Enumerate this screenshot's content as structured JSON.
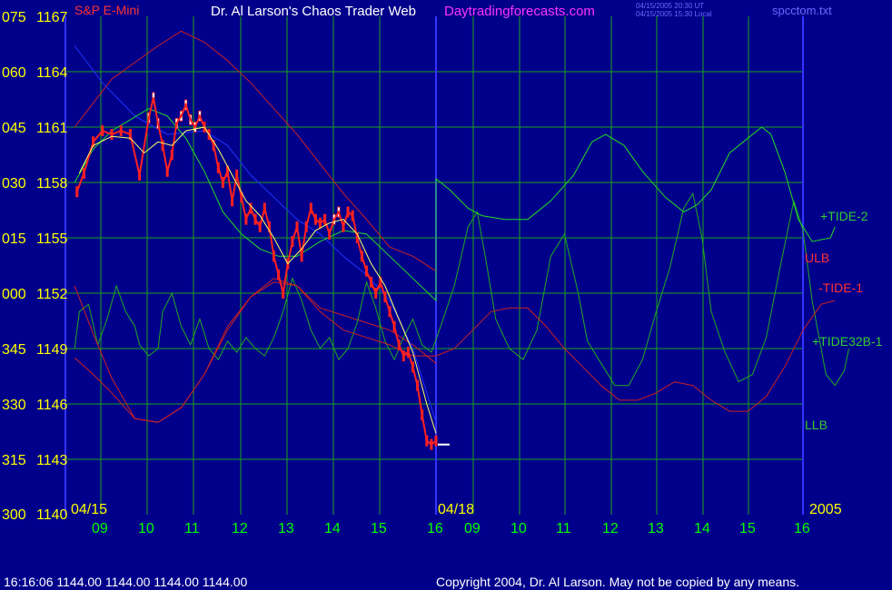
{
  "header": {
    "instrument": "S&P E-Mini",
    "title": "Dr. Al Larson's Chaos Trader Web",
    "site": "Daytradingforecasts.com",
    "stamp_ut": "04/15/2005 20:30 UT",
    "stamp_local": "04/15/2005 15:30 Local",
    "file": "spcctom.txt"
  },
  "footer": {
    "status": "16:16:06  1144.00 1144.00 1144.00 1144.00",
    "copyright": "Copyright 2004, Dr. Al Larson. May not be copied by any means."
  },
  "colors": {
    "background": "#00008b",
    "grid": "#1aa31a",
    "divider": "#3333ff",
    "price": "#ff2020",
    "price_highlight": "#ffffff",
    "ma": "#ffff66",
    "tide2": "#22dd22",
    "tide32b": "#22aa22",
    "tide1": "#cc2222",
    "channel_blue": "#2233ff",
    "lbl_red": "#ff3030",
    "lbl_green": "#33cc33",
    "tick": "#ffff00",
    "hour_tick": "#00ff00"
  },
  "chart_data": {
    "type": "line",
    "title": "",
    "xlabel": "",
    "ylabel": "",
    "ylim": [
      1140,
      1167
    ],
    "y_ticks": [
      {
        "left": "075",
        "right": "1167",
        "value": 1167
      },
      {
        "left": "060",
        "right": "1164",
        "value": 1164
      },
      {
        "left": "045",
        "right": "1161",
        "value": 1161
      },
      {
        "left": "030",
        "right": "1158",
        "value": 1158
      },
      {
        "left": "015",
        "right": "1155",
        "value": 1155
      },
      {
        "left": "000",
        "right": "1152",
        "value": 1152
      },
      {
        "left": "345",
        "right": "1149",
        "value": 1149
      },
      {
        "left": "330",
        "right": "1146",
        "value": 1146
      },
      {
        "left": "315",
        "right": "1143",
        "value": 1143
      },
      {
        "left": "300",
        "right": "1140",
        "value": 1140
      }
    ],
    "x_hours": [
      "09",
      "10",
      "11",
      "12",
      "13",
      "14",
      "15",
      "16",
      "09",
      "10",
      "11",
      "12",
      "13",
      "14",
      "15",
      "16"
    ],
    "date_labels": [
      "04/15",
      "04/18"
    ],
    "year_label": "2005",
    "grid": true,
    "series_labels": [
      {
        "name": "+TIDE-2",
        "color": "lbl_green"
      },
      {
        "name": "ULB",
        "color": "lbl_red"
      },
      {
        "name": "-TIDE-1",
        "color": "lbl_red"
      },
      {
        "name": "+TIDE32B-1",
        "color": "lbl_green"
      },
      {
        "name": "LLB",
        "color": "lbl_green"
      }
    ],
    "x_domain": [
      8.2,
      24.0
    ],
    "price_close": [
      [
        8.25,
        1157.5
      ],
      [
        8.4,
        1158.5
      ],
      [
        8.6,
        1160.2
      ],
      [
        8.8,
        1160.8
      ],
      [
        9.0,
        1160.6
      ],
      [
        9.2,
        1160.8
      ],
      [
        9.4,
        1160.6
      ],
      [
        9.6,
        1158.4
      ],
      [
        9.8,
        1161.5
      ],
      [
        9.9,
        1162.6
      ],
      [
        10.0,
        1161.2
      ],
      [
        10.1,
        1160.0
      ],
      [
        10.2,
        1158.6
      ],
      [
        10.3,
        1159.5
      ],
      [
        10.4,
        1161.2
      ],
      [
        10.5,
        1161.6
      ],
      [
        10.6,
        1162.2
      ],
      [
        10.7,
        1161.4
      ],
      [
        10.8,
        1161.0
      ],
      [
        10.9,
        1161.6
      ],
      [
        11.0,
        1161.0
      ],
      [
        11.1,
        1160.6
      ],
      [
        11.2,
        1160.0
      ],
      [
        11.3,
        1158.8
      ],
      [
        11.4,
        1158.0
      ],
      [
        11.5,
        1158.6
      ],
      [
        11.6,
        1157.0
      ],
      [
        11.7,
        1158.4
      ],
      [
        11.8,
        1157.2
      ],
      [
        11.9,
        1156.0
      ],
      [
        12.0,
        1156.6
      ],
      [
        12.1,
        1156.0
      ],
      [
        12.2,
        1155.6
      ],
      [
        12.3,
        1156.6
      ],
      [
        12.4,
        1155.6
      ],
      [
        12.5,
        1154.0
      ],
      [
        12.6,
        1153.0
      ],
      [
        12.7,
        1152.0
      ],
      [
        12.8,
        1153.6
      ],
      [
        12.9,
        1154.8
      ],
      [
        13.0,
        1155.6
      ],
      [
        13.1,
        1154.0
      ],
      [
        13.2,
        1155.6
      ],
      [
        13.3,
        1156.6
      ],
      [
        13.4,
        1156.0
      ],
      [
        13.5,
        1155.8
      ],
      [
        13.6,
        1156.0
      ],
      [
        13.7,
        1155.2
      ],
      [
        13.8,
        1156.0
      ],
      [
        13.9,
        1156.4
      ],
      [
        14.0,
        1155.6
      ],
      [
        14.1,
        1156.4
      ],
      [
        14.2,
        1156.2
      ],
      [
        14.3,
        1155.0
      ],
      [
        14.4,
        1154.0
      ],
      [
        14.5,
        1153.2
      ],
      [
        14.6,
        1152.6
      ],
      [
        14.7,
        1152.0
      ],
      [
        14.8,
        1152.6
      ],
      [
        14.9,
        1151.8
      ],
      [
        15.0,
        1151.0
      ],
      [
        15.1,
        1150.2
      ],
      [
        15.2,
        1149.2
      ],
      [
        15.3,
        1148.6
      ],
      [
        15.4,
        1148.8
      ],
      [
        15.5,
        1148.0
      ],
      [
        15.6,
        1147.0
      ],
      [
        15.7,
        1145.4
      ],
      [
        15.8,
        1144.0
      ],
      [
        15.9,
        1143.8
      ],
      [
        16.0,
        1144.0
      ]
    ],
    "price_white": [
      [
        9.8,
        1161.5
      ],
      [
        9.9,
        1162.6
      ],
      [
        10.0,
        1161.2
      ],
      [
        10.4,
        1161.2
      ],
      [
        10.5,
        1161.6
      ],
      [
        10.6,
        1162.2
      ],
      [
        10.7,
        1161.4
      ],
      [
        10.8,
        1161.0
      ],
      [
        10.9,
        1161.6
      ],
      [
        13.8,
        1156.0
      ],
      [
        13.9,
        1156.4
      ]
    ],
    "moving_avg": [
      [
        8.3,
        1158.5
      ],
      [
        8.6,
        1160.0
      ],
      [
        9.0,
        1160.5
      ],
      [
        9.4,
        1160.4
      ],
      [
        9.7,
        1159.6
      ],
      [
        10.0,
        1160.2
      ],
      [
        10.3,
        1160.0
      ],
      [
        10.6,
        1160.8
      ],
      [
        11.0,
        1161.0
      ],
      [
        11.3,
        1159.8
      ],
      [
        11.6,
        1158.4
      ],
      [
        11.9,
        1157.0
      ],
      [
        12.2,
        1156.2
      ],
      [
        12.5,
        1155.0
      ],
      [
        12.8,
        1153.6
      ],
      [
        13.1,
        1154.4
      ],
      [
        13.4,
        1155.4
      ],
      [
        13.7,
        1155.8
      ],
      [
        14.0,
        1156.0
      ],
      [
        14.3,
        1155.2
      ],
      [
        14.6,
        1153.6
      ],
      [
        14.9,
        1152.4
      ],
      [
        15.2,
        1150.6
      ],
      [
        15.5,
        1148.8
      ],
      [
        15.8,
        1146.0
      ],
      [
        16.0,
        1144.4
      ]
    ],
    "upper_channel": [
      [
        8.2,
        1161.0
      ],
      [
        9.0,
        1163.6
      ],
      [
        10.0,
        1165.4
      ],
      [
        10.5,
        1166.2
      ],
      [
        11.0,
        1165.6
      ],
      [
        11.5,
        1164.6
      ],
      [
        12.0,
        1163.4
      ],
      [
        12.5,
        1162.0
      ],
      [
        13.0,
        1160.6
      ],
      [
        13.5,
        1159.0
      ],
      [
        14.0,
        1157.4
      ],
      [
        14.5,
        1156.0
      ],
      [
        15.0,
        1154.5
      ],
      [
        15.5,
        1154.0
      ],
      [
        16.0,
        1153.2
      ]
    ],
    "lower_channel": [
      [
        8.2,
        1148.5
      ],
      [
        8.6,
        1147.6
      ],
      [
        9.0,
        1146.6
      ],
      [
        9.5,
        1145.2
      ],
      [
        10.0,
        1145.0
      ],
      [
        10.5,
        1145.8
      ],
      [
        11.0,
        1147.6
      ],
      [
        11.5,
        1150.2
      ],
      [
        12.0,
        1151.8
      ],
      [
        12.5,
        1152.6
      ],
      [
        13.0,
        1152.4
      ],
      [
        13.5,
        1151.2
      ],
      [
        14.0,
        1150.8
      ],
      [
        14.5,
        1150.4
      ],
      [
        15.0,
        1150.0
      ],
      [
        15.5,
        1149.2
      ],
      [
        16.0,
        1148.2
      ]
    ],
    "blue_trend": [
      [
        8.2,
        1165.4
      ],
      [
        8.8,
        1163.4
      ],
      [
        9.5,
        1161.6
      ],
      [
        10.2,
        1160.6
      ],
      [
        11.0,
        1160.8
      ],
      [
        11.5,
        1160.0
      ],
      [
        12.0,
        1158.4
      ],
      [
        12.5,
        1157.2
      ],
      [
        13.0,
        1156.0
      ],
      [
        13.5,
        1155.2
      ],
      [
        14.0,
        1154.0
      ],
      [
        14.5,
        1153.0
      ],
      [
        15.0,
        1151.6
      ],
      [
        15.5,
        1149.0
      ],
      [
        16.0,
        1145.0
      ]
    ],
    "tide2": [
      [
        8.2,
        1158.0
      ],
      [
        8.6,
        1159.8
      ],
      [
        9.0,
        1160.8
      ],
      [
        9.4,
        1161.4
      ],
      [
        9.8,
        1162.0
      ],
      [
        10.2,
        1161.6
      ],
      [
        10.6,
        1160.4
      ],
      [
        11.0,
        1158.6
      ],
      [
        11.4,
        1156.4
      ],
      [
        11.8,
        1155.2
      ],
      [
        12.2,
        1154.4
      ],
      [
        12.6,
        1154.0
      ],
      [
        13.0,
        1154.0
      ],
      [
        13.5,
        1154.8
      ],
      [
        14.0,
        1155.4
      ],
      [
        14.5,
        1155.2
      ],
      [
        15.0,
        1154.0
      ],
      [
        15.5,
        1152.8
      ],
      [
        16.0,
        1151.6
      ],
      [
        16.0,
        1158.2
      ],
      [
        16.3,
        1157.6
      ],
      [
        16.7,
        1156.6
      ],
      [
        17.0,
        1156.2
      ],
      [
        17.5,
        1156.0
      ],
      [
        18.0,
        1156.0
      ],
      [
        18.5,
        1157.0
      ],
      [
        19.0,
        1158.4
      ],
      [
        19.4,
        1160.2
      ],
      [
        19.7,
        1160.6
      ],
      [
        20.1,
        1160.0
      ],
      [
        20.5,
        1158.6
      ],
      [
        21.0,
        1157.2
      ],
      [
        21.4,
        1156.4
      ],
      [
        21.7,
        1156.8
      ],
      [
        22.0,
        1157.6
      ],
      [
        22.4,
        1159.6
      ],
      [
        22.8,
        1160.4
      ],
      [
        23.1,
        1161.0
      ],
      [
        23.3,
        1160.6
      ],
      [
        23.6,
        1158.6
      ],
      [
        23.9,
        1156.0
      ],
      [
        24.2,
        1154.8
      ],
      [
        24.6,
        1155.0
      ],
      [
        24.7,
        1155.6
      ]
    ],
    "tide1": [
      [
        8.2,
        1152.4
      ],
      [
        8.6,
        1149.8
      ],
      [
        9.0,
        1147.4
      ],
      [
        9.5,
        1145.2
      ],
      [
        10.0,
        1145.0
      ],
      [
        10.5,
        1145.8
      ],
      [
        11.0,
        1147.6
      ],
      [
        11.5,
        1150.0
      ],
      [
        12.0,
        1151.8
      ],
      [
        12.5,
        1152.8
      ],
      [
        13.0,
        1152.4
      ],
      [
        13.5,
        1151.0
      ],
      [
        14.0,
        1150.0
      ],
      [
        14.5,
        1149.6
      ],
      [
        15.0,
        1149.2
      ],
      [
        15.5,
        1148.6
      ],
      [
        16.0,
        1148.6
      ],
      [
        16.4,
        1149.0
      ],
      [
        16.8,
        1150.0
      ],
      [
        17.2,
        1151.0
      ],
      [
        17.6,
        1151.2
      ],
      [
        18.0,
        1151.2
      ],
      [
        18.4,
        1150.2
      ],
      [
        18.8,
        1149.0
      ],
      [
        19.2,
        1148.0
      ],
      [
        19.6,
        1147.0
      ],
      [
        20.0,
        1146.2
      ],
      [
        20.4,
        1146.2
      ],
      [
        20.8,
        1146.6
      ],
      [
        21.2,
        1147.2
      ],
      [
        21.6,
        1147.0
      ],
      [
        22.0,
        1146.2
      ],
      [
        22.4,
        1145.6
      ],
      [
        22.8,
        1145.6
      ],
      [
        23.2,
        1146.4
      ],
      [
        23.6,
        1148.0
      ],
      [
        24.0,
        1150.0
      ],
      [
        24.4,
        1151.4
      ],
      [
        24.7,
        1151.6
      ]
    ],
    "tide32b": [
      [
        8.2,
        1149.0
      ],
      [
        8.3,
        1151.0
      ],
      [
        8.5,
        1151.4
      ],
      [
        8.7,
        1149.2
      ],
      [
        8.9,
        1150.6
      ],
      [
        9.1,
        1152.4
      ],
      [
        9.3,
        1151.0
      ],
      [
        9.5,
        1150.2
      ],
      [
        9.6,
        1149.2
      ],
      [
        9.8,
        1148.6
      ],
      [
        10.0,
        1149.0
      ],
      [
        10.1,
        1151.0
      ],
      [
        10.3,
        1152.0
      ],
      [
        10.5,
        1150.2
      ],
      [
        10.7,
        1149.2
      ],
      [
        10.9,
        1150.6
      ],
      [
        11.1,
        1149.0
      ],
      [
        11.3,
        1148.4
      ],
      [
        11.5,
        1149.4
      ],
      [
        11.7,
        1148.8
      ],
      [
        11.9,
        1149.6
      ],
      [
        12.1,
        1149.0
      ],
      [
        12.3,
        1148.6
      ],
      [
        12.5,
        1149.6
      ],
      [
        12.7,
        1151.0
      ],
      [
        12.9,
        1152.8
      ],
      [
        13.1,
        1151.6
      ],
      [
        13.3,
        1150.0
      ],
      [
        13.5,
        1149.0
      ],
      [
        13.7,
        1149.6
      ],
      [
        13.9,
        1148.4
      ],
      [
        14.1,
        1149.0
      ],
      [
        14.3,
        1150.4
      ],
      [
        14.5,
        1152.6
      ],
      [
        14.7,
        1151.2
      ],
      [
        14.9,
        1149.4
      ],
      [
        15.1,
        1148.4
      ],
      [
        15.3,
        1149.6
      ],
      [
        15.5,
        1150.6
      ],
      [
        15.7,
        1149.2
      ],
      [
        15.9,
        1148.8
      ],
      [
        16.1,
        1150.2
      ],
      [
        16.4,
        1152.4
      ],
      [
        16.7,
        1155.6
      ],
      [
        16.9,
        1156.4
      ],
      [
        17.1,
        1153.6
      ],
      [
        17.3,
        1150.6
      ],
      [
        17.6,
        1149.0
      ],
      [
        17.9,
        1148.4
      ],
      [
        18.2,
        1150.0
      ],
      [
        18.5,
        1154.0
      ],
      [
        18.8,
        1155.2
      ],
      [
        19.1,
        1152.0
      ],
      [
        19.3,
        1149.4
      ],
      [
        19.6,
        1148.2
      ],
      [
        19.9,
        1147.0
      ],
      [
        20.2,
        1147.0
      ],
      [
        20.5,
        1148.4
      ],
      [
        20.8,
        1151.0
      ],
      [
        21.1,
        1153.4
      ],
      [
        21.4,
        1156.6
      ],
      [
        21.6,
        1157.4
      ],
      [
        21.8,
        1155.0
      ],
      [
        22.0,
        1151.0
      ],
      [
        22.3,
        1148.8
      ],
      [
        22.6,
        1147.2
      ],
      [
        22.9,
        1147.6
      ],
      [
        23.2,
        1149.6
      ],
      [
        23.5,
        1153.4
      ],
      [
        23.8,
        1157.0
      ],
      [
        24.0,
        1155.4
      ],
      [
        24.2,
        1151.6
      ],
      [
        24.5,
        1147.6
      ],
      [
        24.7,
        1147.0
      ],
      [
        24.9,
        1147.8
      ],
      [
        25.0,
        1149.0
      ]
    ],
    "last_price_marker": 1143.8
  }
}
